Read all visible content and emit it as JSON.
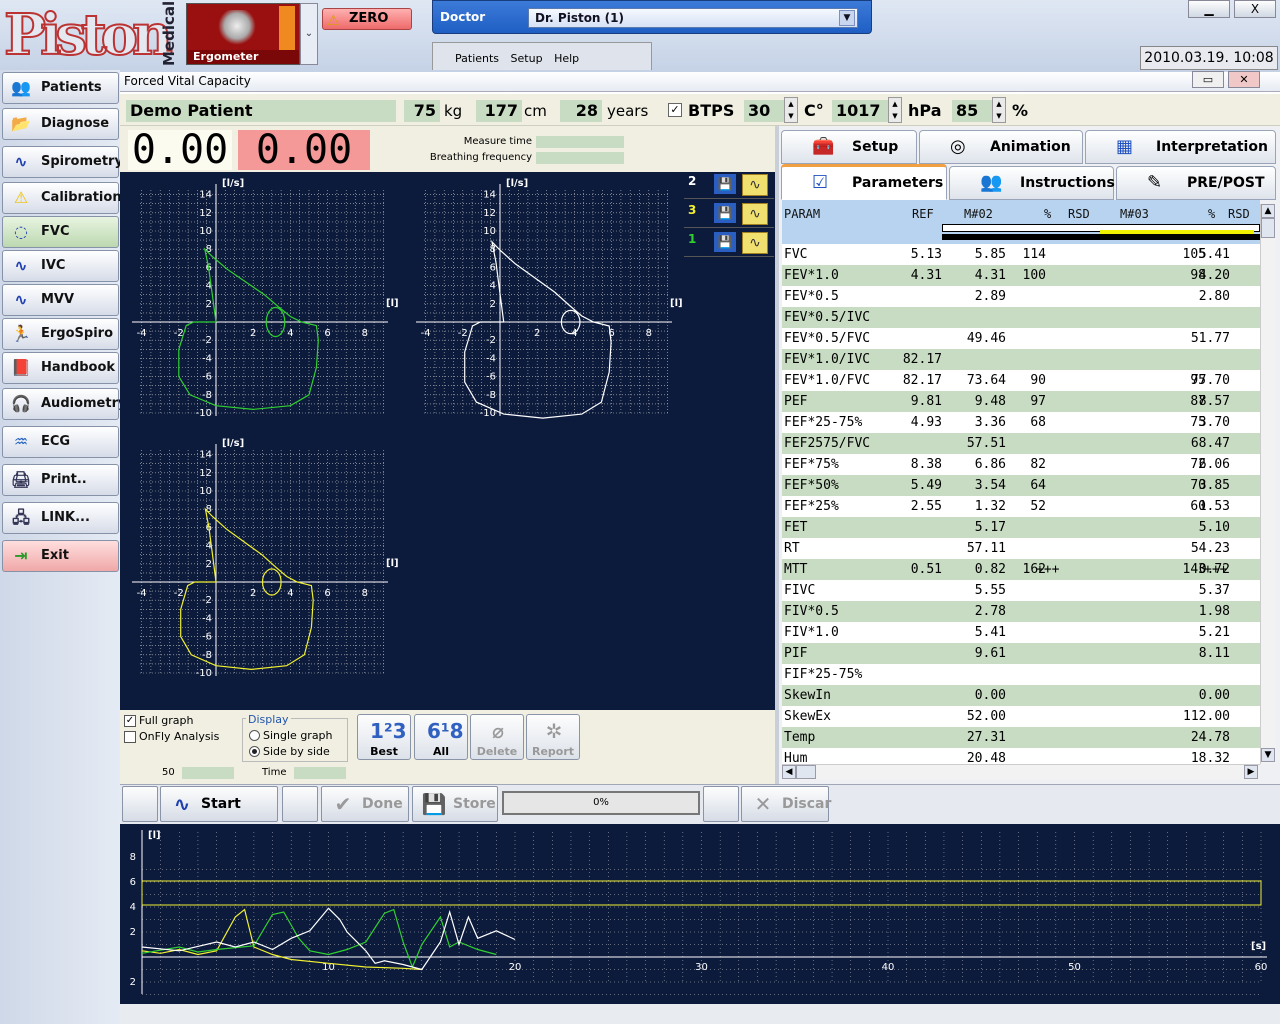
{
  "header": {
    "logo_text": "Piston",
    "logo_sub": "Medical",
    "device_label": "Ergometer",
    "zero_label": "ZERO",
    "doctor_label": "Doctor",
    "doctor_value": "Dr. Piston (1)",
    "menu": [
      "Patients",
      "Setup",
      "Help"
    ],
    "datetime": "2010.03.19. 10:08",
    "window_minimize": "▁",
    "window_close": "X"
  },
  "sidebar": {
    "items": [
      {
        "label": "Patients",
        "icon": "people-icon"
      },
      {
        "label": "Diagnose",
        "icon": "folder-icon"
      },
      {
        "label": "Spirometry",
        "icon": "wave-icon"
      },
      {
        "label": "Calibration",
        "icon": "warning-icon"
      },
      {
        "label": "FVC",
        "icon": "lung-loop-icon"
      },
      {
        "label": "IVC",
        "icon": "wave-icon"
      },
      {
        "label": "MVV",
        "icon": "wave-icon"
      },
      {
        "label": "ErgoSpiro",
        "icon": "runner-icon"
      },
      {
        "label": "Handbook",
        "icon": "book-icon"
      },
      {
        "label": "Audiometry",
        "icon": "headphones-icon"
      },
      {
        "label": "ECG",
        "icon": "ecg-icon"
      },
      {
        "label": "Print..",
        "icon": "printer-icon"
      },
      {
        "label": "LINK...",
        "icon": "network-icon"
      },
      {
        "label": "Exit",
        "icon": "exit-icon"
      }
    ],
    "selected": "FVC"
  },
  "form": {
    "title": "Forced Vital Capacity",
    "patient_name": "Demo Patient",
    "weight": "75",
    "weight_unit": "kg",
    "height": "177",
    "height_unit": "cm",
    "age": "28",
    "age_unit": "years",
    "btps_label": "BTPS",
    "btps_checked": true,
    "temp": "30",
    "temp_unit": "C°",
    "pressure": "1017",
    "pressure_unit": "hPa",
    "humidity": "85",
    "humidity_unit": "%",
    "readout1": "0.00",
    "readout2": "0.00",
    "measure_time_label": "Measure time",
    "breathing_freq_label": "Breathing frequency"
  },
  "plots": {
    "y_unit": "[l/s]",
    "x_unit": "[l]",
    "y_ticks": [
      "14",
      "12",
      "10",
      "8",
      "6",
      "4",
      "2",
      "-2",
      "-4",
      "-6",
      "-8",
      "-10"
    ],
    "x_ticks": [
      "-4",
      "-2",
      "2",
      "4",
      "6",
      "8"
    ],
    "sequence": [
      {
        "num": "2",
        "color": "#ffffff"
      },
      {
        "num": "3",
        "color": "#f0f030"
      },
      {
        "num": "1",
        "color": "#30d030"
      }
    ]
  },
  "controls": {
    "full_graph_label": "Full graph",
    "full_graph_checked": true,
    "onfly_label": "OnFly Analysis",
    "onfly_checked": false,
    "display_label": "Display",
    "single_graph_label": "Single graph",
    "side_by_side_label": "Side by side",
    "display_selected": "Side by side",
    "fifty_label": "50",
    "time_label": "Time",
    "best_label": "Best",
    "all_label": "All",
    "delete_label": "Delete",
    "report_label": "Report"
  },
  "tabs": {
    "row1": [
      "Setup",
      "Animation",
      "Interpretation"
    ],
    "row2": [
      "Parameters",
      "Instructions",
      "PRE/POST"
    ],
    "active": "Parameters"
  },
  "table": {
    "headers": [
      "PARAM",
      "REF",
      "M#02",
      "%",
      "RSD",
      "M#03",
      "%",
      "RSD"
    ],
    "rows": [
      [
        "FVC",
        "5.13",
        "5.85",
        "114",
        "",
        "5.41",
        "105",
        ""
      ],
      [
        "FEV*1.0",
        "4.31",
        "4.31",
        "100",
        "",
        "4.20",
        "98",
        ""
      ],
      [
        "FEV*0.5",
        "",
        "2.89",
        "",
        "",
        "2.80",
        "",
        ""
      ],
      [
        "FEV*0.5/IVC",
        "",
        "",
        "",
        "",
        "",
        "",
        ""
      ],
      [
        "FEV*0.5/FVC",
        "",
        "49.46",
        "",
        "",
        "51.77",
        "",
        ""
      ],
      [
        "FEV*1.0/IVC",
        "82.17",
        "",
        "",
        "",
        "",
        "",
        ""
      ],
      [
        "FEV*1.0/FVC",
        "82.17",
        "73.64",
        "90",
        "",
        "77.70",
        "95",
        ""
      ],
      [
        "PEF",
        "9.81",
        "9.48",
        "97",
        "",
        "8.57",
        "87",
        ""
      ],
      [
        "FEF*25-75%",
        "4.93",
        "3.36",
        "68",
        "",
        "3.70",
        "75",
        ""
      ],
      [
        "FEF2575/FVC",
        "",
        "57.51",
        "",
        "",
        "68.47",
        "",
        ""
      ],
      [
        "FEF*75%",
        "8.38",
        "6.86",
        "82",
        "",
        "6.06",
        "72",
        ""
      ],
      [
        "FEF*50%",
        "5.49",
        "3.54",
        "64",
        "",
        "3.85",
        "70",
        ""
      ],
      [
        "FEF*25%",
        "2.55",
        "1.32",
        "52",
        "",
        "1.53",
        "60",
        ""
      ],
      [
        "FET",
        "",
        "5.17",
        "",
        "",
        "5.10",
        "",
        ""
      ],
      [
        "RT",
        "",
        "57.11",
        "",
        "",
        "54.23",
        "",
        ""
      ],
      [
        "MTT",
        "0.51",
        "0.82",
        "162",
        "+++",
        "0.72",
        "143",
        "+++"
      ],
      [
        "FIVC",
        "",
        "5.55",
        "",
        "",
        "5.37",
        "",
        ""
      ],
      [
        "FIV*0.5",
        "",
        "2.78",
        "",
        "",
        "1.98",
        "",
        ""
      ],
      [
        "FIV*1.0",
        "",
        "5.41",
        "",
        "",
        "5.21",
        "",
        ""
      ],
      [
        "PIF",
        "",
        "9.61",
        "",
        "",
        "8.11",
        "",
        ""
      ],
      [
        "FIF*25-75%",
        "",
        "",
        "",
        "",
        "",
        "",
        ""
      ],
      [
        "SkewIn",
        "",
        "0.00",
        "",
        "",
        "0.00",
        "",
        ""
      ],
      [
        "SkewEx",
        "",
        "52.00",
        "",
        "",
        "112.00",
        "",
        ""
      ],
      [
        "Temp",
        "",
        "27.31",
        "",
        "",
        "24.78",
        "",
        ""
      ],
      [
        "Hum",
        "",
        "20.48",
        "",
        "",
        "18.32",
        "",
        ""
      ]
    ]
  },
  "commands": {
    "start": "Start",
    "done": "Done",
    "store": "Store",
    "progress": "0%",
    "discard": "Discar"
  },
  "time_graph": {
    "y_unit": "[l]",
    "x_unit": "[s]",
    "y_ticks": [
      "8",
      "6",
      "4",
      "2",
      "2"
    ],
    "x_ticks": [
      "10",
      "20",
      "30",
      "40",
      "50",
      "60"
    ]
  },
  "colors": {
    "graph_bg": "#0c1a3c",
    "grid": "#c0c0c0",
    "curve1": "#30d030",
    "curve2": "#ffffff",
    "curve3": "#f0f030",
    "green_field": "#c8dcc3",
    "red_field": "#f59898"
  }
}
